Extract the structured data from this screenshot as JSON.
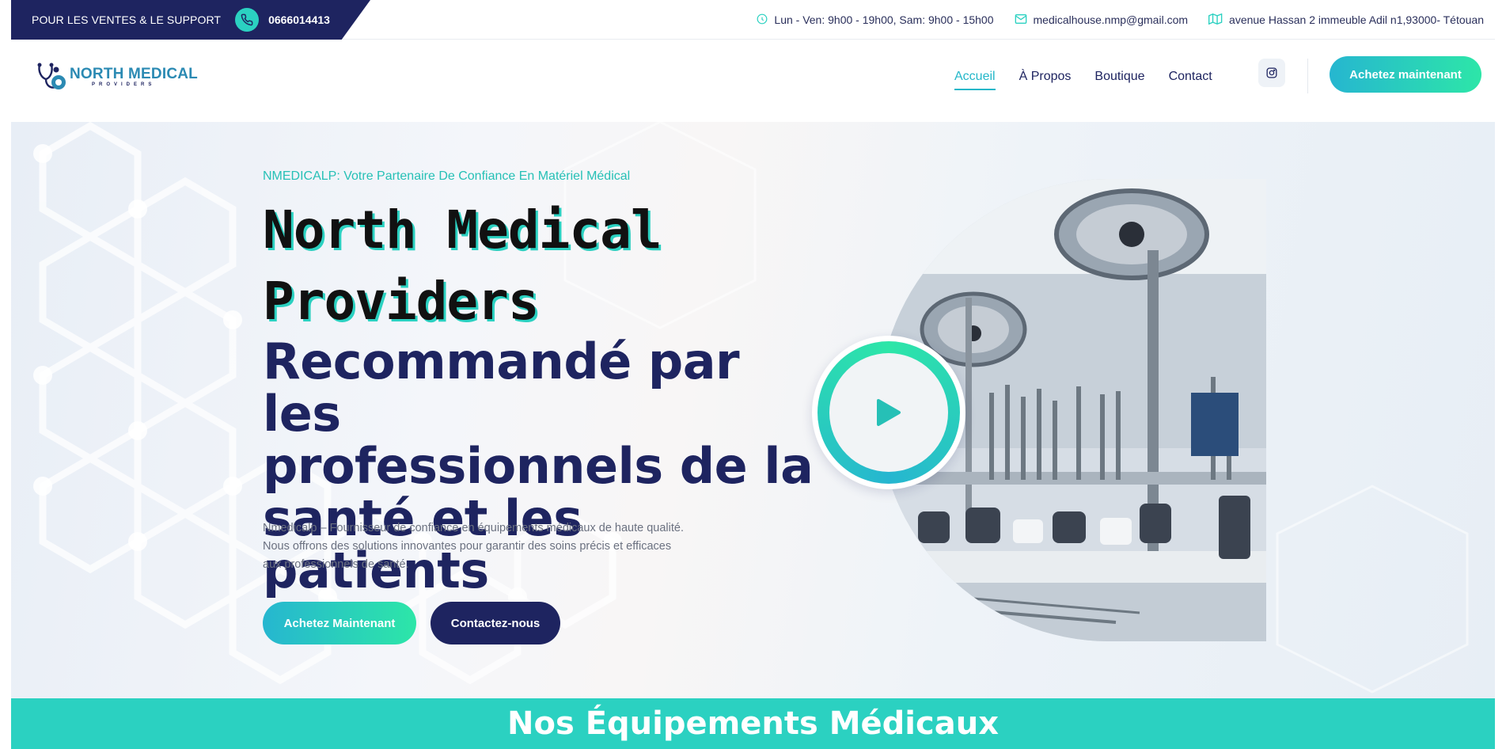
{
  "topbar": {
    "support_label": "POUR LES VENTES & LE SUPPORT",
    "phone": "0666014413",
    "hours": "Lun - Ven: 9h00 - 19h00, Sam: 9h00 - 15h00",
    "email": "medicalhouse.nmp@gmail.com",
    "address": "avenue Hassan 2 immeuble Adil n1,93000- Tétouan"
  },
  "header": {
    "logo_main": "NORTH MEDICAL",
    "logo_sub": "PROVIDERS",
    "menu": [
      {
        "label": "Accueil",
        "active": true
      },
      {
        "label": "À Propos",
        "active": false
      },
      {
        "label": "Boutique",
        "active": false
      },
      {
        "label": "Contact",
        "active": false
      }
    ],
    "cta_label": "Achetez maintenant"
  },
  "hero": {
    "eyebrow": "NMEDICALP: Votre Partenaire De Confiance En Matériel Médical",
    "title_line1": "North Medical",
    "title_line2": "Providers",
    "subtitle_line1": "Recommandé par les",
    "subtitle_line2": "professionnels de la",
    "subtitle_line3": "santé et les patients",
    "description_line1": "Nmedicalp – Fournisseur de confiance en équipements médicaux de haute qualité.",
    "description_line2": "Nous offrons des solutions innovantes pour garantir des soins précis et efficaces",
    "description_line3": "aux professionnels de santé.",
    "button_primary": "Achetez Maintenant",
    "button_secondary": "Contactez-nous"
  },
  "section": {
    "title": "Nos Équipements Médicaux"
  },
  "colors": {
    "navy": "#1e2460",
    "teal": "#2bd1c1",
    "accent_gradient_start": "#26b6d0",
    "accent_gradient_end": "#2de6a8"
  }
}
